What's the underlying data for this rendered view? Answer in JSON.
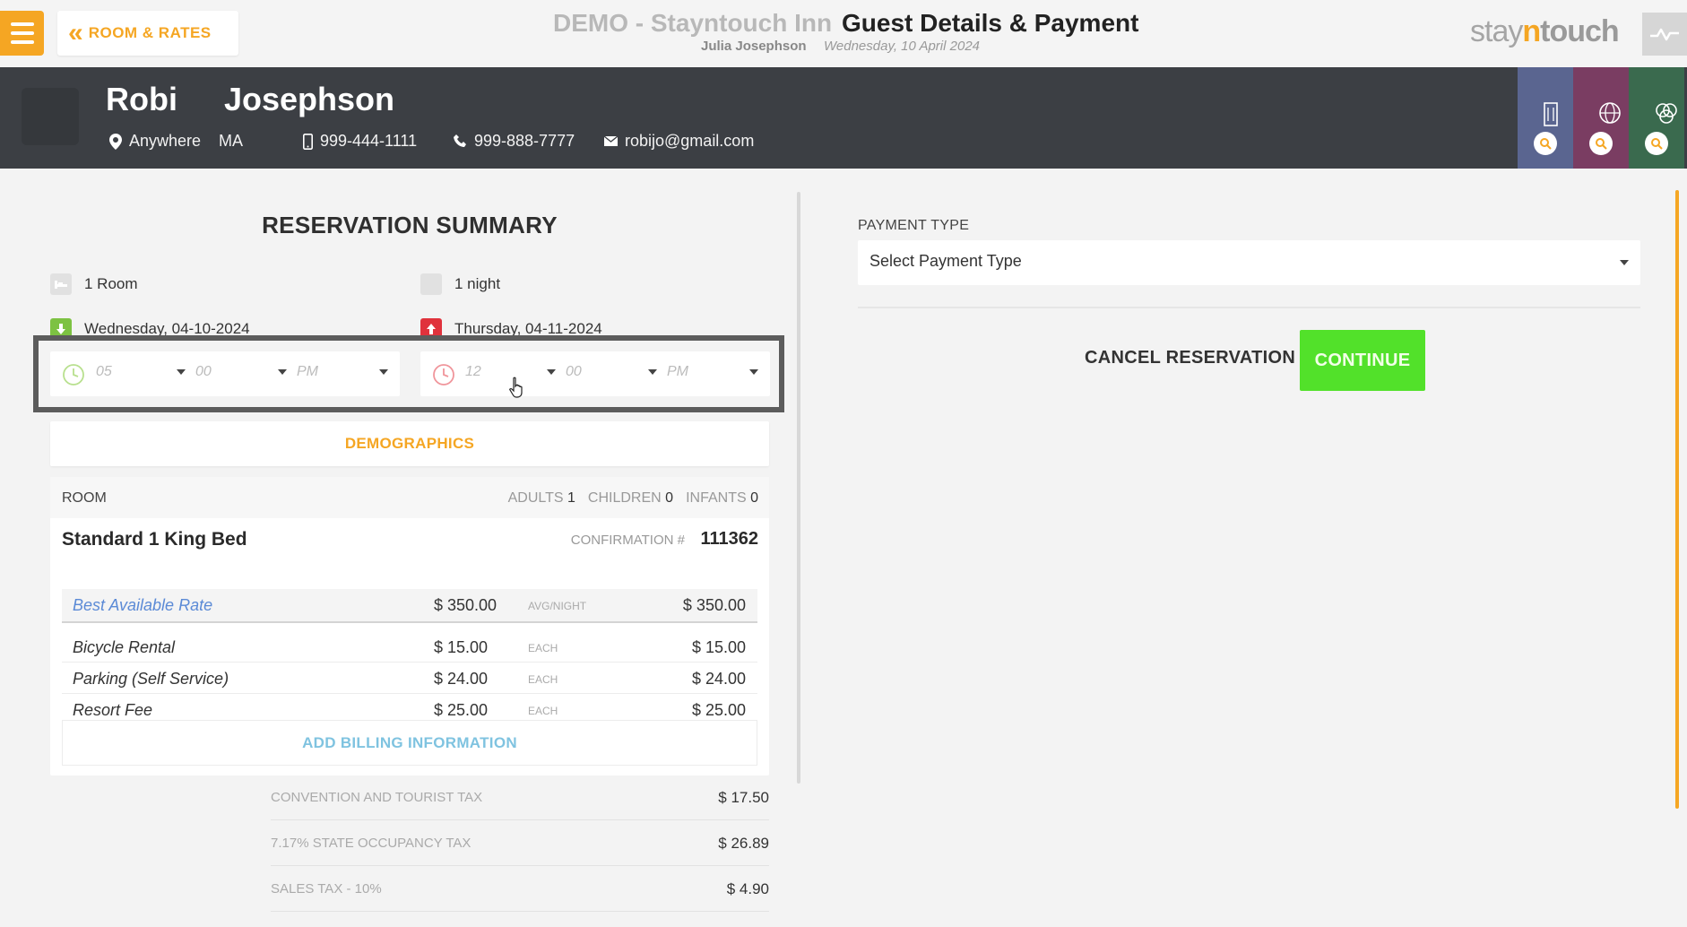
{
  "header": {
    "back_label": "ROOM & RATES",
    "hotel_name": "DEMO - Stayntouch Inn",
    "page_title": "Guest Details & Payment",
    "user_name": "Julia Josephson",
    "business_date": "Wednesday, 10 April 2024",
    "brand": {
      "part1": "stay",
      "part2": "n",
      "part3": "touch"
    }
  },
  "guest": {
    "first_name": "Robi",
    "last_name": "Josephson",
    "city": "Anywhere",
    "state": "MA",
    "mobile": "999-444-1111",
    "phone": "999-888-7777",
    "email": "robijo@gmail.com"
  },
  "search_tabs": [
    {
      "icon": "building-icon",
      "color": "#5a6590"
    },
    {
      "icon": "globe-icon",
      "color": "#7a3d62"
    },
    {
      "icon": "group-icon",
      "color": "#3a6a4e"
    }
  ],
  "summary": {
    "title": "RESERVATION SUMMARY",
    "rooms": "1 Room",
    "nights": "1 night",
    "arrival_date": "Wednesday, 04-10-2024",
    "departure_date": "Thursday, 04-11-2024",
    "arrival_time": {
      "hour": "05",
      "minute": "00",
      "ampm": "PM"
    },
    "departure_time": {
      "hour": "12",
      "minute": "00",
      "ampm": "PM"
    },
    "demographics_label": "DEMOGRAPHICS"
  },
  "room": {
    "label": "ROOM",
    "adults_label": "ADULTS",
    "adults": "1",
    "children_label": "CHILDREN",
    "children": "0",
    "infants_label": "INFANTS",
    "infants": "0",
    "type": "Standard 1 King Bed",
    "confirmation_label": "CONFIRMATION #",
    "confirmation_no": "111362",
    "rate": {
      "name": "Best Available Rate",
      "price": "$ 350.00",
      "tag": "AVG/NIGHT",
      "total": "$ 350.00"
    },
    "addons": [
      {
        "name": "Bicycle Rental",
        "price": "$ 15.00",
        "tag": "EACH",
        "total": "$ 15.00"
      },
      {
        "name": "Parking (Self Service)",
        "price": "$ 24.00",
        "tag": "EACH",
        "total": "$ 24.00"
      },
      {
        "name": "Resort Fee",
        "price": "$ 25.00",
        "tag": "EACH",
        "total": "$ 25.00"
      }
    ],
    "add_billing_label": "ADD BILLING INFORMATION"
  },
  "taxes": [
    {
      "name": "CONVENTION AND TOURIST TAX",
      "amount": "$ 17.50"
    },
    {
      "name": "7.17% STATE OCCUPANCY TAX",
      "amount": "$ 26.89"
    },
    {
      "name": "SALES TAX - 10%",
      "amount": "$ 4.90"
    }
  ],
  "payment": {
    "type_label": "PAYMENT TYPE",
    "type_value": "Select Payment Type",
    "cancel_label": "CANCEL RESERVATION",
    "continue_label": "CONTINUE"
  },
  "colors": {
    "accent": "#f5a623",
    "continue": "#52e12a",
    "guest_bar": "#3c3f44",
    "arrival_icon": "#7dc242",
    "departure_icon": "#e0323c",
    "link": "#5b8ad6"
  }
}
